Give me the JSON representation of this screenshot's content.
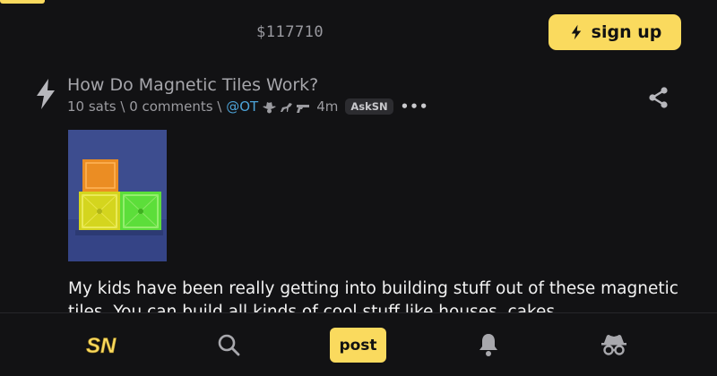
{
  "header": {
    "price": "$117710",
    "signup_label": "sign up"
  },
  "post": {
    "title": "How Do Magnetic Tiles Work?",
    "sats": "10 sats",
    "sep1": "\\",
    "comments": "0 comments",
    "sep2": "\\",
    "user": "@OT",
    "time": "4m",
    "badge": "AskSN",
    "more": "•••",
    "body": "My kids have been really getting into building stuff out of these magnetic tiles. You can build all kinds of cool stuff like houses, cakes"
  },
  "bottom_nav": {
    "logo": "SN",
    "post_label": "post"
  },
  "icons": [
    "bolt-icon",
    "share-icon",
    "search-icon",
    "bell-icon",
    "incognito-icon",
    "cowboy-icon",
    "horse-icon",
    "gun-icon"
  ],
  "colors": {
    "accent": "#fada5e",
    "background": "#121214",
    "link": "#4da3d8"
  }
}
